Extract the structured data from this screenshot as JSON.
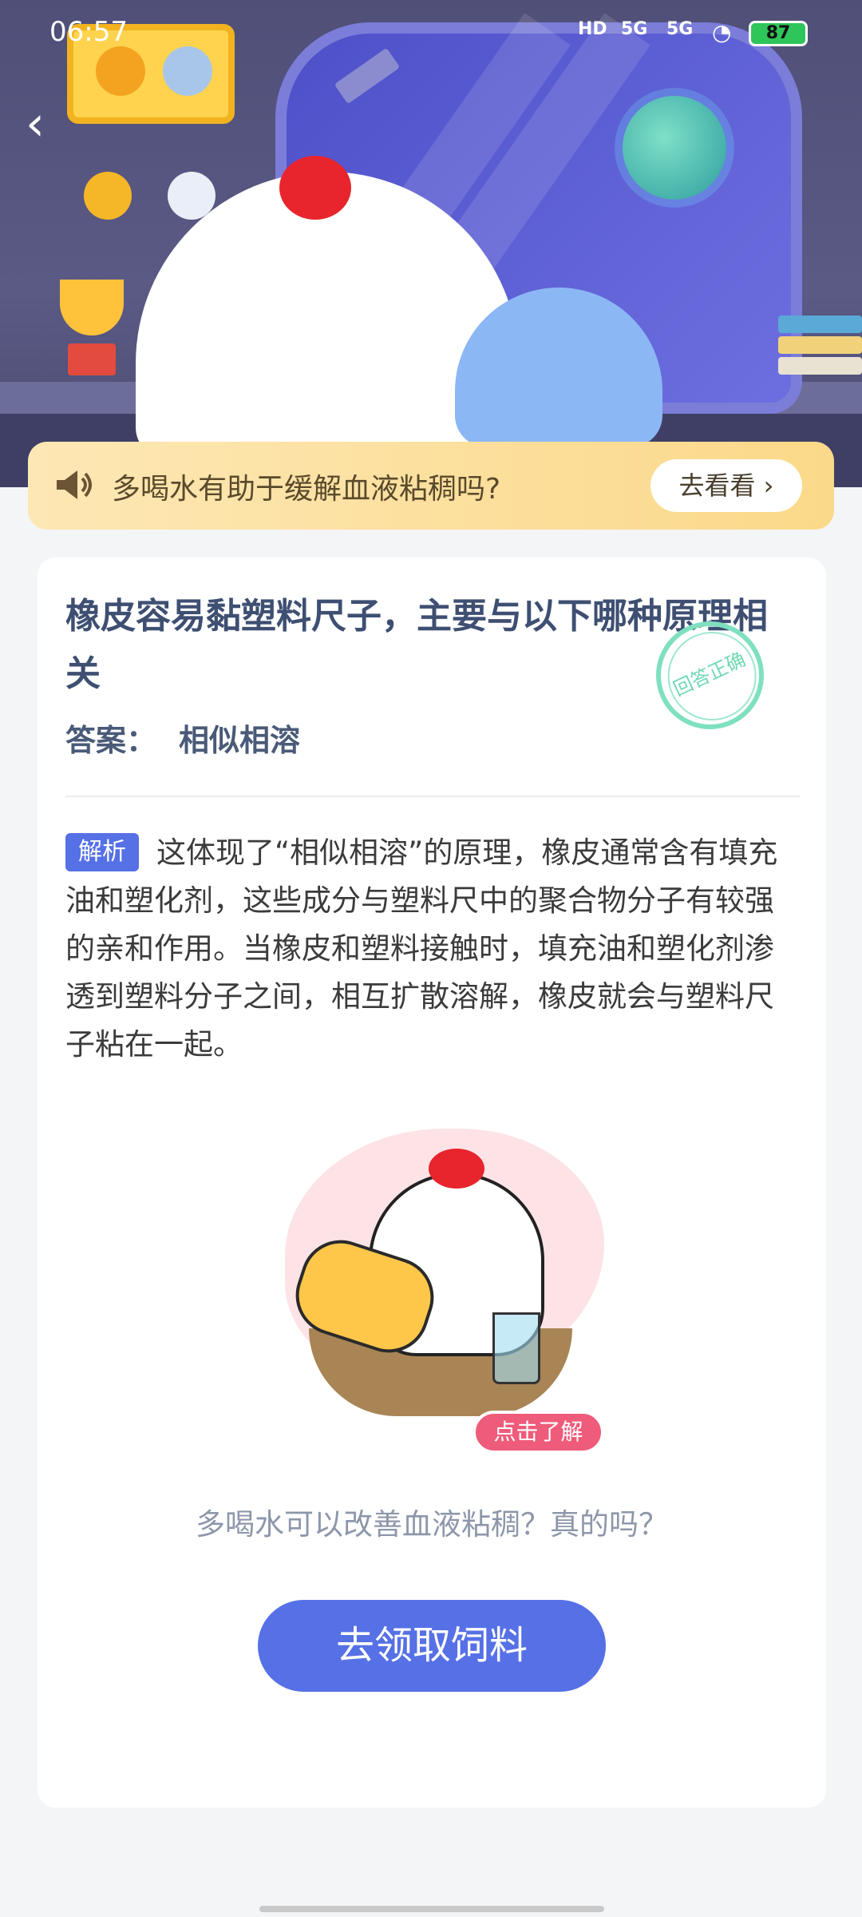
{
  "status_bar": {
    "time": "06:57",
    "hd": "HD",
    "net1": "5G",
    "net2": "5G",
    "battery": "87"
  },
  "notice": {
    "text": "多喝水有助于缓解血液粘稠吗?",
    "button": "去看看 ›"
  },
  "question": {
    "title": "橡皮容易黏塑料尺子，主要与以下哪种原理相关",
    "answer_label": "答案：",
    "answer_value": "相似相溶",
    "stamp": "回答正确"
  },
  "analysis": {
    "tag": "解析",
    "text": "这体现了“相似相溶”的原理，橡皮通常含有填充油和塑化剂，这些成分与塑料尺中的聚合物分子有较强的亲和作用。当橡皮和塑料接触时，填充油和塑化剂渗透到塑料分子之间，相互扩散溶解，橡皮就会与塑料尺子粘在一起。"
  },
  "promo": {
    "learn_more": "点击了解",
    "subtitle": "多喝水可以改善血液粘稠？真的吗？",
    "cta": "去领取饲料"
  },
  "colors": {
    "primary": "#5670e6",
    "banner": "#fbd98a",
    "stamp": "#7fe0bf"
  }
}
